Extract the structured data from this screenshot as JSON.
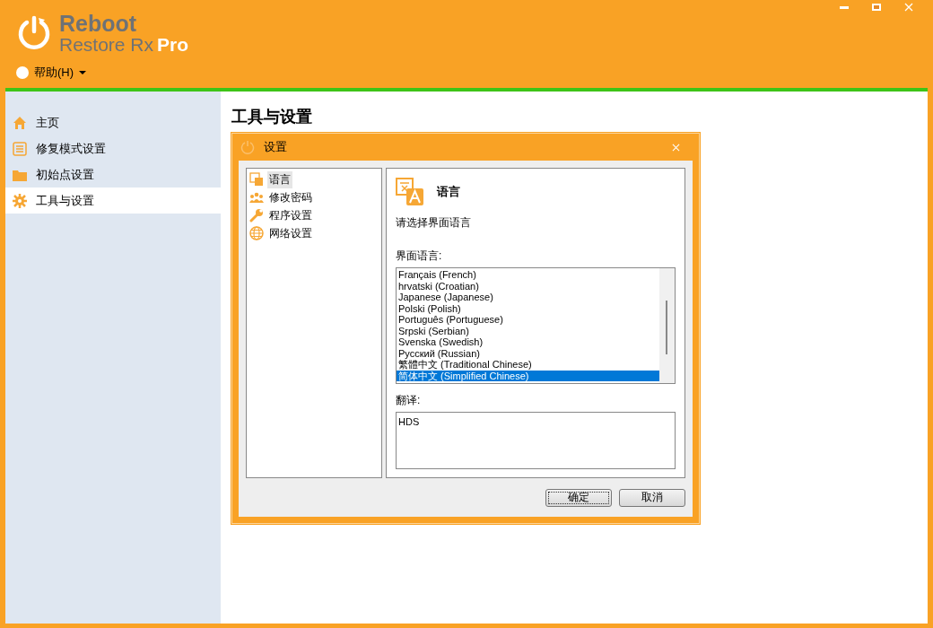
{
  "logo": {
    "line1": "Reboot",
    "line2": "Restore Rx",
    "edition": "Pro"
  },
  "menu": [
    {
      "label": "帮助(H)"
    }
  ],
  "sidebar": {
    "items": [
      {
        "label": "主页",
        "selected": false
      },
      {
        "label": "修复模式设置",
        "selected": false
      },
      {
        "label": "初始点设置",
        "selected": false
      },
      {
        "label": "工具与设置",
        "selected": true
      }
    ]
  },
  "page": {
    "title": "工具与设置"
  },
  "dialog": {
    "title": "设置",
    "nav": [
      {
        "label": "语言",
        "selected": true
      },
      {
        "label": "修改密码",
        "selected": false
      },
      {
        "label": "程序设置",
        "selected": false
      },
      {
        "label": "网络设置",
        "selected": false
      }
    ],
    "section_title": "语言",
    "prompt": "请选择界面语言",
    "language_label": "界面语言:",
    "languages": [
      {
        "label": "Français (French)",
        "selected": false
      },
      {
        "label": "hrvatski (Croatian)",
        "selected": false
      },
      {
        "label": "Japanese (Japanese)",
        "selected": false
      },
      {
        "label": "Polski (Polish)",
        "selected": false
      },
      {
        "label": "Português (Portuguese)",
        "selected": false
      },
      {
        "label": "Srpski (Serbian)",
        "selected": false
      },
      {
        "label": "Svenska (Swedish)",
        "selected": false
      },
      {
        "label": "Русский (Russian)",
        "selected": false
      },
      {
        "label": "繁體中文 (Traditional Chinese)",
        "selected": false
      },
      {
        "label": "简体中文 (Simplified Chinese)",
        "selected": true
      }
    ],
    "translation_label": "翻译:",
    "translation": "HDS",
    "buttons": [
      {
        "label": "确定",
        "default": true
      },
      {
        "label": "取消",
        "default": false
      }
    ]
  }
}
